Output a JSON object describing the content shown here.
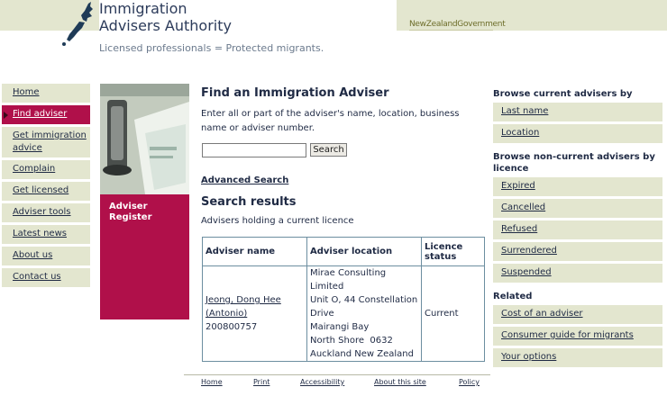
{
  "header": {
    "org_line1": "Immigration",
    "org_line2": "Advisers Authority",
    "tagline": "Licensed professionals = Protected migrants.",
    "govt_new": "New",
    "govt_zealand": "Zealand",
    "govt_government": "Government"
  },
  "left_nav": [
    {
      "label": "Home"
    },
    {
      "label": "Find adviser",
      "active": true
    },
    {
      "label": "Get immigration advice"
    },
    {
      "label": "Complain"
    },
    {
      "label": "Get licensed"
    },
    {
      "label": "Adviser tools"
    },
    {
      "label": "Latest news"
    },
    {
      "label": "About us"
    },
    {
      "label": "Contact us"
    }
  ],
  "register_label": "Adviser Register",
  "main": {
    "title": "Find an Immigration Adviser",
    "intro": "Enter all or part of the adviser's name, location, business name or adviser number.",
    "search_value": "",
    "search_button": "Search",
    "advanced_link": "Advanced Search",
    "results_title": "Search results",
    "results_subtitle": "Advisers holding a current licence"
  },
  "results_table": {
    "headers": [
      "Adviser name",
      "Adviser location",
      "Licence status"
    ],
    "rows": [
      {
        "name_line1": "Jeong, Dong Hee",
        "name_line2": "(Antonio)",
        "number": "200800757",
        "location": [
          "Mirae Consulting Limited",
          "Unit O, 44 Constellation",
          "Drive",
          "Mairangi Bay",
          "North Shore  0632",
          "Auckland New Zealand"
        ],
        "status": "Current"
      }
    ]
  },
  "right_nav": {
    "current_heading": "Browse current advisers by",
    "current_items": [
      "Last name",
      "Location"
    ],
    "noncurrent_heading": "Browse non-current advisers by licence",
    "noncurrent_items": [
      "Expired",
      "Cancelled",
      "Refused",
      "Surrendered",
      "Suspended"
    ],
    "related_heading": "Related",
    "related_items": [
      "Cost of an adviser",
      "Consumer guide for migrants",
      "Your options"
    ]
  },
  "footer": [
    "Home",
    "Print",
    "Accessibility",
    "About this site",
    "Policy"
  ],
  "colors": {
    "accent": "#b0104a",
    "nav_bg": "#e3e6cf",
    "text": "#1f2a44"
  }
}
